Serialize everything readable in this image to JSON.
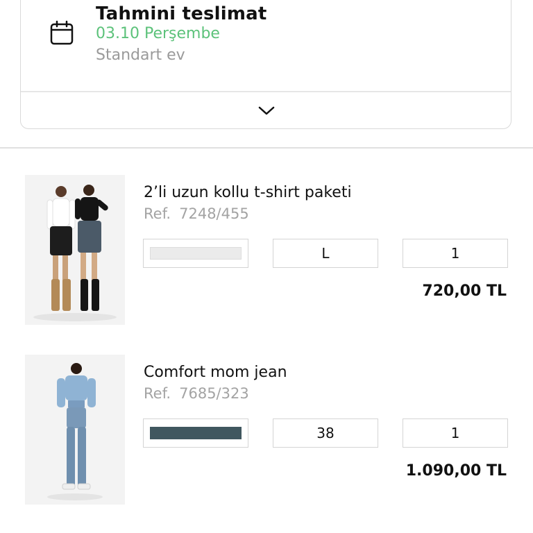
{
  "delivery": {
    "title": "Tahmini teslimat",
    "date": "03.10 Perşembe",
    "method": "Standart ev",
    "icon": "calendar-icon",
    "date_color": "#5cc27a"
  },
  "items": [
    {
      "name": "2’li uzun kollu t-shirt paketi",
      "ref_label": "Ref.",
      "ref": "7248/455",
      "color_swatch": "#ebebeb",
      "size": "L",
      "quantity": "1",
      "price": "720,00 TL"
    },
    {
      "name": "Comfort mom jean",
      "ref_label": "Ref.",
      "ref": "7685/323",
      "color_swatch": "#40575f",
      "size": "38",
      "quantity": "1",
      "price": "1.090,00 TL"
    }
  ]
}
